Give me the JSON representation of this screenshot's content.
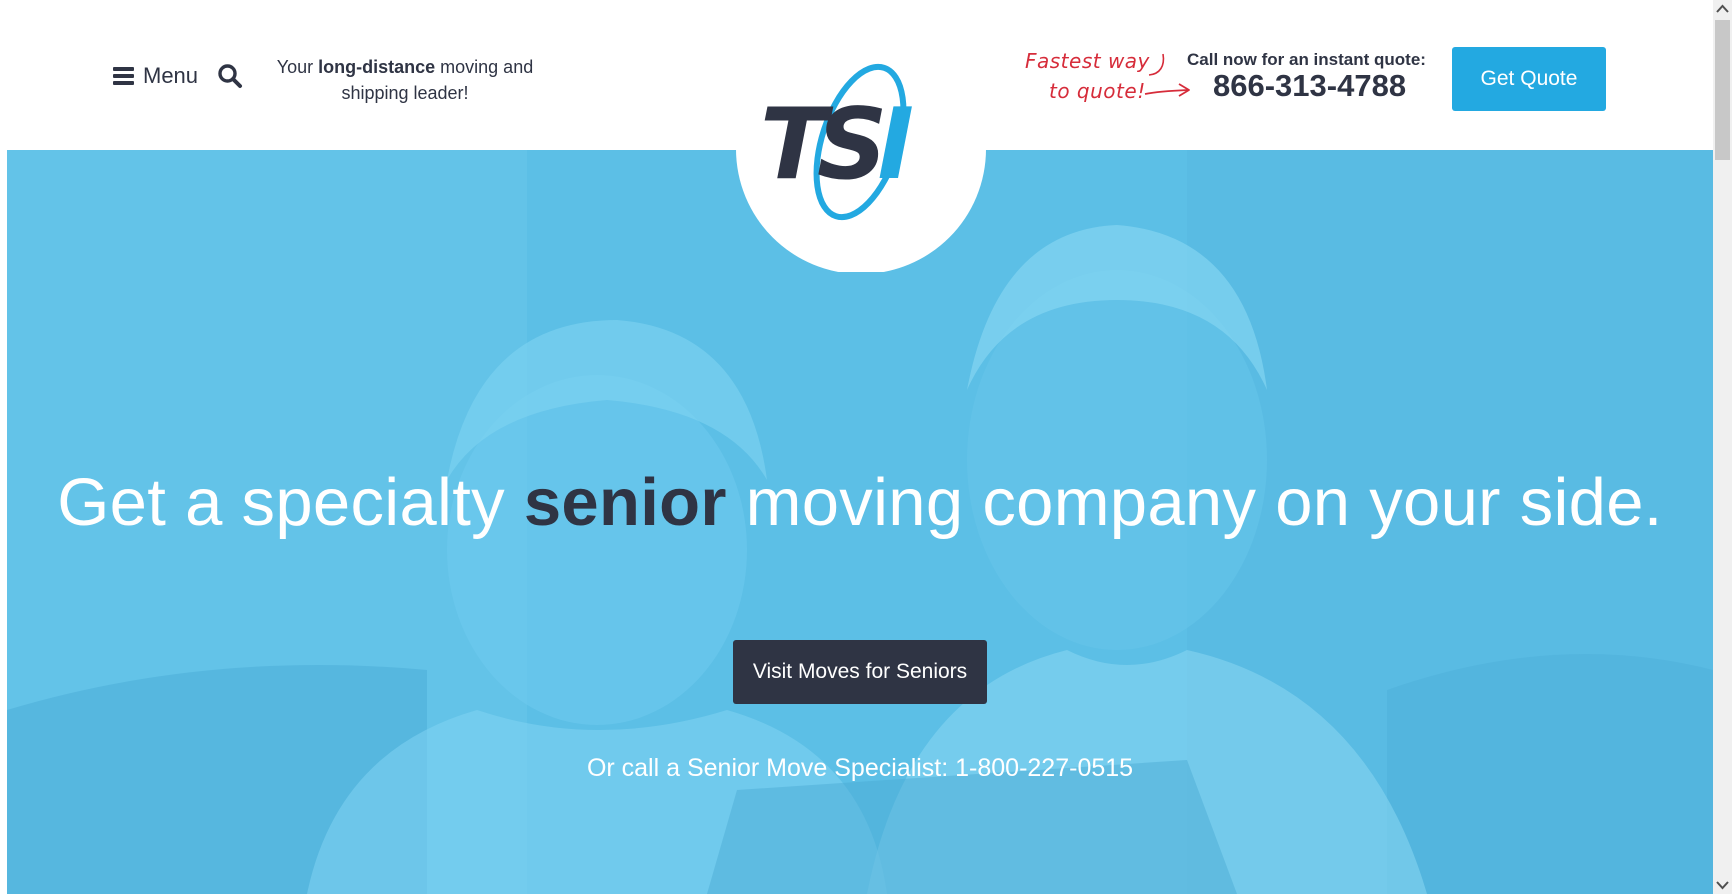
{
  "header": {
    "menu_label": "Menu",
    "tagline_prefix": "Your ",
    "tagline_bold": "long-distance",
    "tagline_suffix": " moving and shipping leader!",
    "fastest_line1": "Fastest way",
    "fastest_line2": "to quote!",
    "call_label": "Call now for an instant quote:",
    "phone": "866-313-4788",
    "quote_button": "Get Quote"
  },
  "logo": {
    "text": "TSI",
    "colors": {
      "dark": "#2f3444",
      "blue": "#23a9e1"
    }
  },
  "hero": {
    "headline_lead": "Get a specialty ",
    "headline_accent": "senior",
    "headline_trail": " moving company on your side.",
    "cta_label": "Visit Moves for Seniors",
    "call_text": "Or call a Senior Move Specialist: 1-800-227-0515"
  },
  "icons": {
    "menu": "hamburger-icon",
    "search": "search-icon",
    "scroll_up": "chevron-up-icon",
    "scroll_down": "chevron-down-icon"
  },
  "colors": {
    "brand_blue": "#23a9e1",
    "brand_dark": "#2f3444",
    "hero_overlay": "#5cbfe6",
    "accent_red": "#d62c3a"
  }
}
